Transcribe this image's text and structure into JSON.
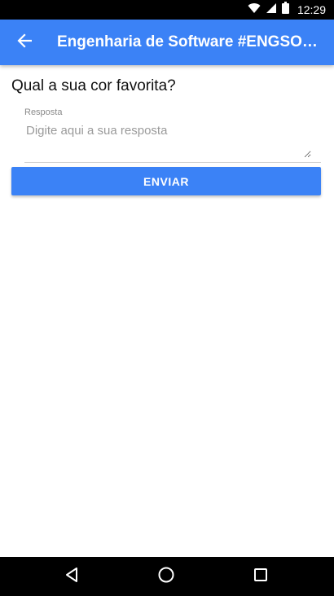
{
  "status_bar": {
    "time": "12:29",
    "icons": [
      "wifi-icon",
      "signal-icon",
      "battery-icon"
    ]
  },
  "app_bar": {
    "title": "Engenharia de Software #ENGSOF...",
    "back_icon": "arrow-left-icon",
    "color": "#3b82f6"
  },
  "form": {
    "question": "Qual a sua cor favorita?",
    "field_label": "Resposta",
    "placeholder": "Digite aqui a sua resposta",
    "value": "",
    "submit_label": "ENVIAR"
  },
  "nav_bar": {
    "icons": [
      "back-triangle-icon",
      "home-circle-icon",
      "recents-square-icon"
    ]
  },
  "colors": {
    "accent": "#3b82f6",
    "status_bar": "#000000",
    "nav_bar": "#000000"
  }
}
